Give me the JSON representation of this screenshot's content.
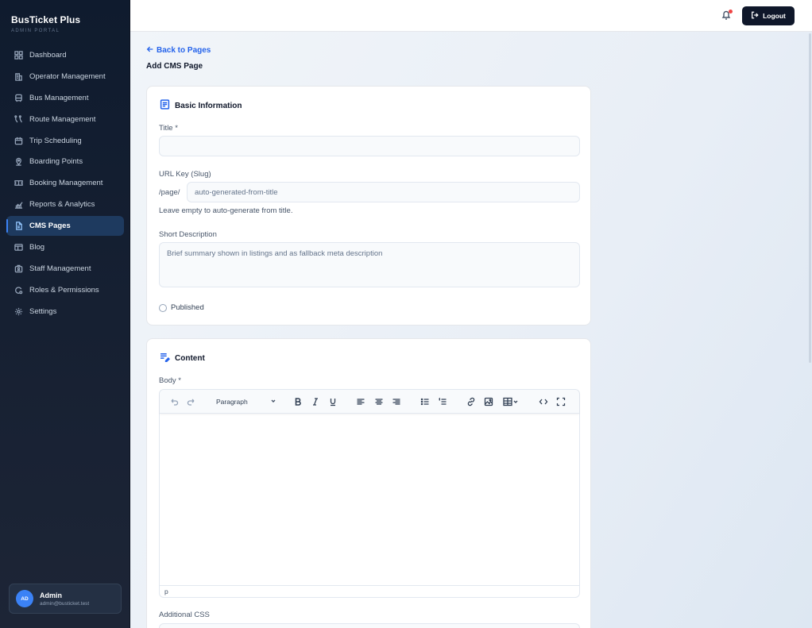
{
  "app": {
    "brand": "BusTicket Plus",
    "subtitle": "ADMIN PORTAL"
  },
  "sidebar": {
    "items": [
      {
        "label": "Dashboard",
        "icon": "dashboard-icon"
      },
      {
        "label": "Operator Management",
        "icon": "building-icon"
      },
      {
        "label": "Bus Management",
        "icon": "bus-icon"
      },
      {
        "label": "Route Management",
        "icon": "route-icon"
      },
      {
        "label": "Trip Scheduling",
        "icon": "calendar-icon"
      },
      {
        "label": "Boarding Points",
        "icon": "map-pin-icon"
      },
      {
        "label": "Booking Management",
        "icon": "ticket-icon"
      },
      {
        "label": "Reports & Analytics",
        "icon": "chart-icon"
      },
      {
        "label": "CMS Pages",
        "icon": "file-icon",
        "active": true
      },
      {
        "label": "Blog",
        "icon": "newspaper-icon"
      },
      {
        "label": "Staff Management",
        "icon": "staff-icon"
      },
      {
        "label": "Roles & Permissions",
        "icon": "shield-icon"
      },
      {
        "label": "Settings",
        "icon": "gear-icon"
      }
    ]
  },
  "user": {
    "initials": "AD",
    "name": "Admin",
    "email": "admin@busticket.test"
  },
  "topbar": {
    "logout_label": "Logout"
  },
  "page": {
    "back_label": "Back to Pages",
    "title": "Add CMS Page"
  },
  "basic": {
    "heading": "Basic Information",
    "title_label": "Title *",
    "title_value": "",
    "slug_label": "URL Key (Slug)",
    "slug_prefix": "/page/",
    "slug_placeholder": "auto-generated-from-title",
    "slug_hint": "Leave empty to auto-generate from title.",
    "short_desc_label": "Short Description",
    "short_desc_placeholder": "Brief summary shown in listings and as fallback meta description",
    "published_label": "Published"
  },
  "content": {
    "heading": "Content",
    "body_label": "Body *",
    "format_select": "Paragraph",
    "status_path": "p",
    "additional_css_label": "Additional CSS"
  },
  "colors": {
    "accent": "#2563eb",
    "sidebar_bg": "#0f1b2e",
    "active_bg": "#1e3a5f",
    "dark_button": "#0f172a"
  }
}
